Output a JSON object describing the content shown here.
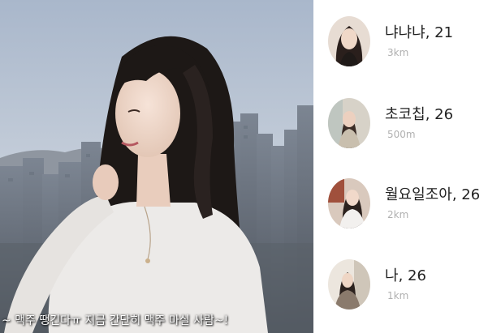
{
  "caption": "~ 맥주 땡긴다ㅠ 지금 간단히 맥주 마실 사람~!",
  "profiles": [
    {
      "name": "냐냐냐",
      "age": "21",
      "distance": "3km"
    },
    {
      "name": "초코칩",
      "age": "26",
      "distance": "500m"
    },
    {
      "name": "월요일조아",
      "age": "26",
      "distance": "2km"
    },
    {
      "name": "나",
      "age": "26",
      "distance": "1km"
    }
  ],
  "colors": {
    "sky": "#b9c4d4",
    "name_text": "#222222",
    "distance_text": "#b0b0b0"
  }
}
